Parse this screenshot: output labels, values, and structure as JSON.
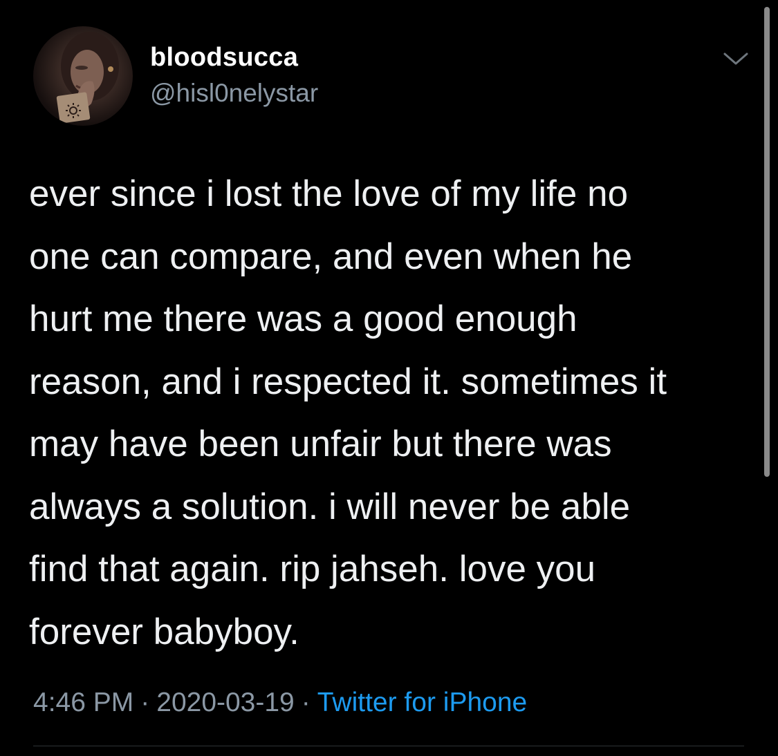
{
  "author": {
    "display_name": "bloodsucca",
    "handle": "@hisl0nelystar",
    "avatar_icon": "profile-photo"
  },
  "menu": {
    "icon": "chevron-down-icon"
  },
  "tweet": {
    "lines": [
      "ever since i lost the love of my life no",
      "one can compare, and even when he",
      "hurt me there was a good enough",
      "reason, and i respected it. sometimes it",
      "may have been unfair but there was",
      "always a solution. i will never be able",
      "find that again. rip jahseh. love you",
      "forever babyboy."
    ]
  },
  "meta": {
    "time": "4:46 PM",
    "separator": "·",
    "date": "2020-03-19",
    "source": "Twitter for iPhone"
  },
  "colors": {
    "background": "#000000",
    "text": "#eef0f2",
    "muted": "#8b98a5",
    "link": "#1d9bf0"
  }
}
